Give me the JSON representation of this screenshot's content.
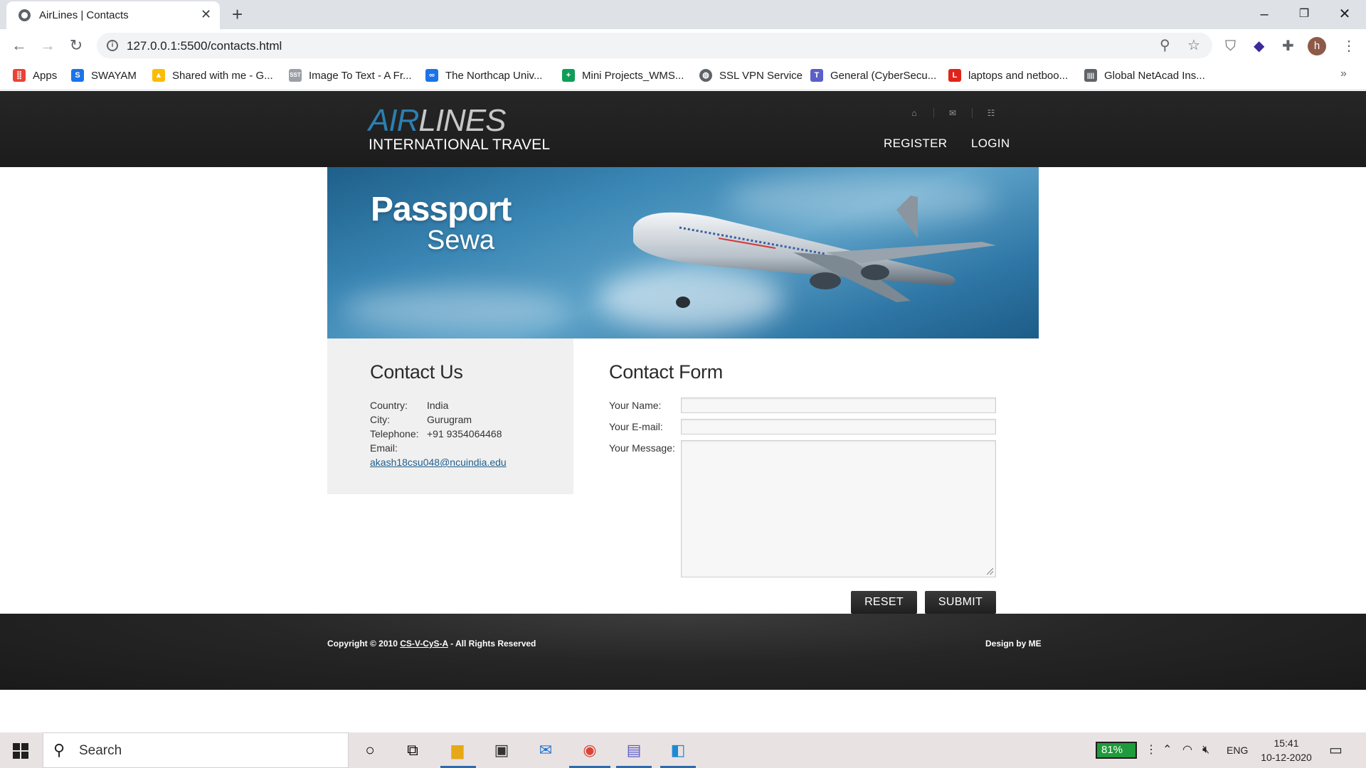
{
  "browser": {
    "tab_title": "AirLines | Contacts",
    "url": "127.0.0.1:5500/contacts.html",
    "bookmarks": [
      {
        "label": "Apps",
        "icon": "apps-grid-icon",
        "color": "#ea4335"
      },
      {
        "label": "SWAYAM",
        "icon": "swayam-icon",
        "color": "#1a73e8"
      },
      {
        "label": "Shared with me - G...",
        "icon": "google-drive-icon",
        "color": "#fbbc04"
      },
      {
        "label": "Image To Text - A Fr...",
        "icon": "sst-icon",
        "color": "#9aa0a6"
      },
      {
        "label": "The Northcap Univ...",
        "icon": "northcap-icon",
        "color": "#1a73e8"
      },
      {
        "label": "Mini Projects_WMS...",
        "icon": "google-sheets-icon",
        "color": "#0f9d58"
      },
      {
        "label": "SSL VPN Service",
        "icon": "globe-icon",
        "color": "#5f6368"
      },
      {
        "label": "General (CyberSecu...",
        "icon": "teams-icon",
        "color": "#5b5fc7"
      },
      {
        "label": "laptops and netboo...",
        "icon": "lenovo-icon",
        "color": "#e2231a"
      },
      {
        "label": "Global NetAcad Ins...",
        "icon": "cisco-icon",
        "color": "#5f6368"
      }
    ],
    "avatar_letter": "h"
  },
  "site": {
    "logo_air": "AIR",
    "logo_lines": "LINES",
    "logo_sub": "INTERNATIONAL TRAVEL",
    "nav": {
      "register": "REGISTER",
      "login": "LOGIN"
    },
    "banner": {
      "title": "Passport",
      "subtitle": "Sewa"
    }
  },
  "contact": {
    "heading": "Contact Us",
    "rows": [
      {
        "label": "Country:",
        "value": "India"
      },
      {
        "label": "City:",
        "value": "Gurugram"
      },
      {
        "label": "Telephone:",
        "value": "+91 9354064468"
      },
      {
        "label": "Email:",
        "value": ""
      }
    ],
    "email_link": "akash18csu048@ncuindia.edu"
  },
  "form": {
    "heading": "Contact Form",
    "name_label": "Your Name:",
    "email_label": "Your E-mail:",
    "message_label": "Your Message:",
    "name_value": "",
    "email_value": "",
    "message_value": "",
    "reset_label": "RESET",
    "submit_label": "SUBMIT"
  },
  "footer": {
    "copyright_prefix": "Copyright © 2010 ",
    "copyright_link": "CS-V-CyS-A",
    "copyright_suffix": " - All Rights Reserved",
    "design": "Design by ME"
  },
  "taskbar": {
    "search_placeholder": "Search",
    "battery": "81%",
    "language": "ENG",
    "time": "15:41",
    "date": "10-12-2020"
  }
}
